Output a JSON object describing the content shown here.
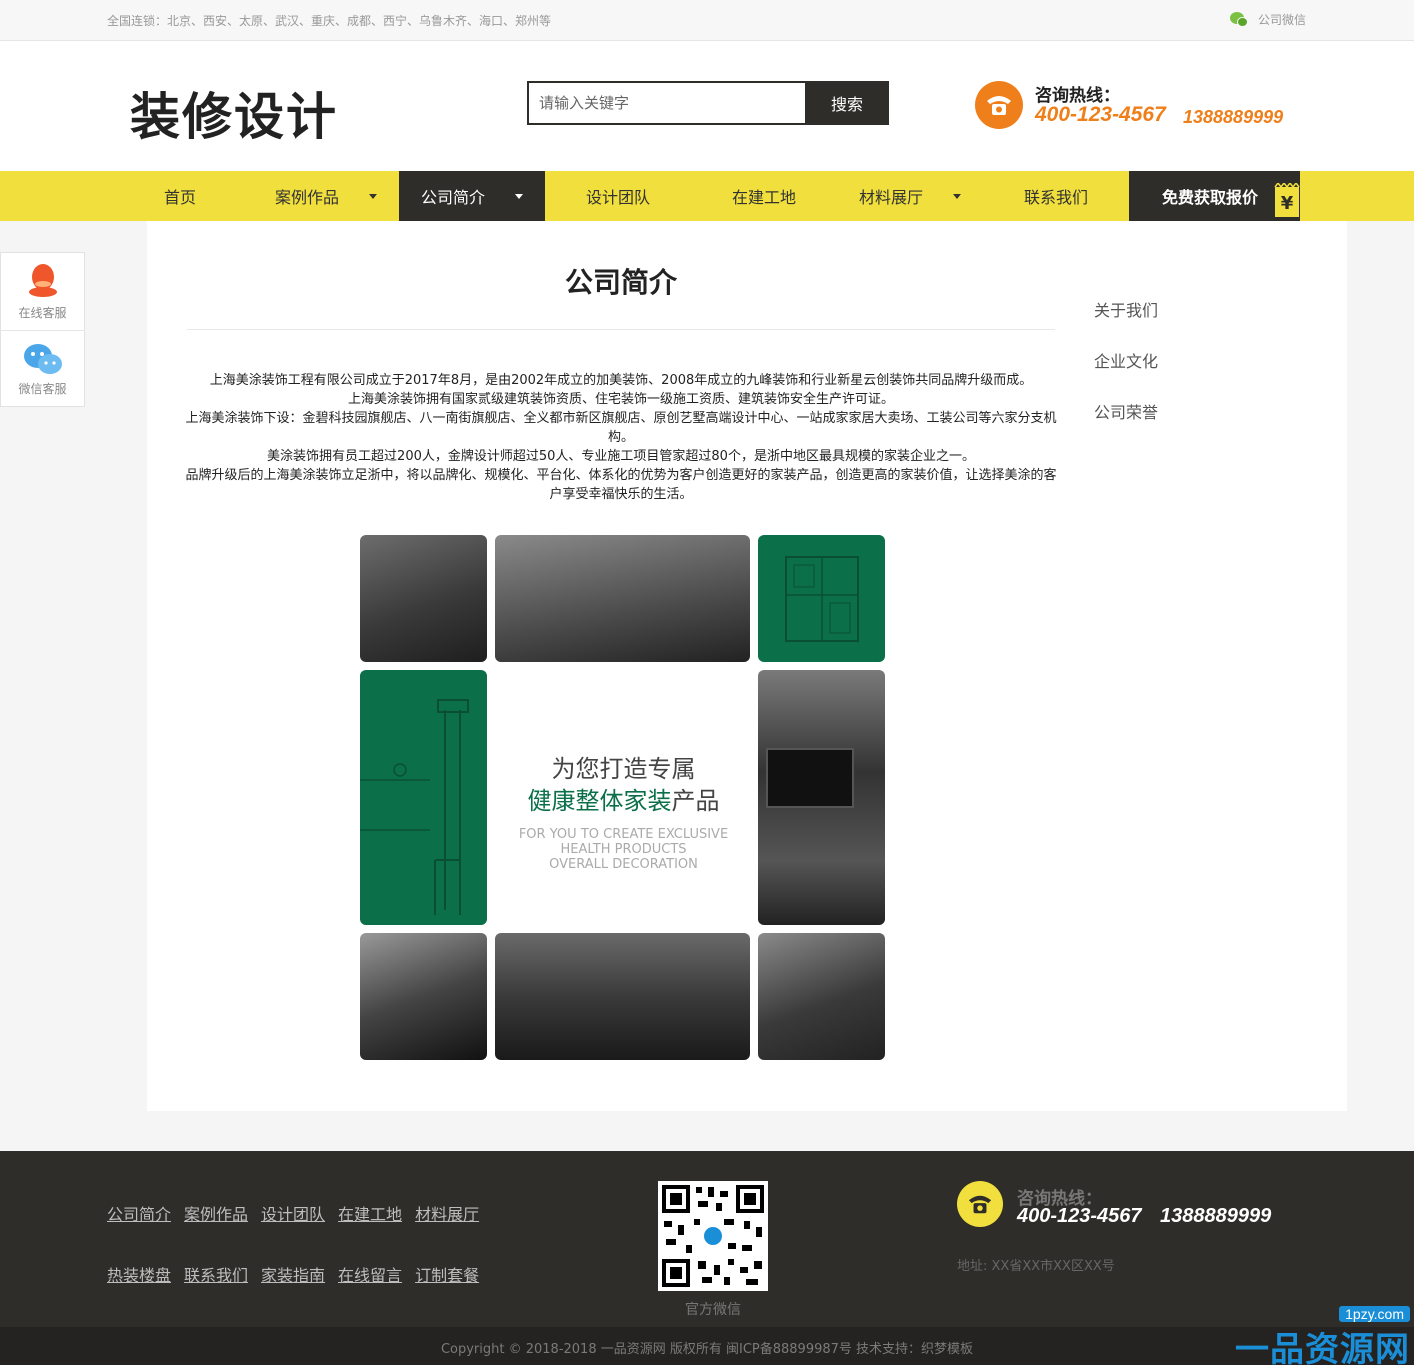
{
  "topbar": {
    "cities": "全国连锁：北京、西安、太原、武汉、重庆、成都、西宁、乌鲁木齐、海口、郑州等",
    "wechat_label": "公司微信"
  },
  "header": {
    "logo": "装修设计",
    "search_placeholder": "请输入关键字",
    "search_button": "搜索",
    "hotline_label": "咨询热线：",
    "hotline_main": "400-123-4567",
    "hotline_mobile": "1388889999"
  },
  "nav": {
    "items": [
      {
        "label": "首页"
      },
      {
        "label": "案例作品"
      },
      {
        "label": "公司简介"
      },
      {
        "label": "设计团队"
      },
      {
        "label": "在建工地"
      },
      {
        "label": "材料展厅"
      },
      {
        "label": "联系我们"
      }
    ],
    "quote_label": "免费获取报价",
    "quote_symbol": "¥"
  },
  "sidefloat": {
    "online_service": "在线客服",
    "wechat_service": "微信客服"
  },
  "main": {
    "title": "公司简介",
    "intro": [
      "上海美涂装饰工程有限公司成立于2017年8月，是由2002年成立的加美装饰、2008年成立的九峰装饰和行业新星云创装饰共同品牌升级而成。",
      "上海美涂装饰拥有国家贰级建筑装饰资质、住宅装饰一级施工资质、建筑装饰安全生产许可证。",
      "上海美涂装饰下设：金碧科技园旗舰店、八一南街旗舰店、全义都市新区旗舰店、原创艺墅高端设计中心、一站成家家居大卖场、工装公司等六家分支机构。",
      "美涂装饰拥有员工超过200人，金牌设计师超过50人、专业施工项目管家超过80个，是浙中地区最具规模的家装企业之一。",
      "品牌升级后的上海美涂装饰立足浙中，将以品牌化、规模化、平台化、体系化的优势为客户创造更好的家装产品，创造更高的家装价值，让选择美涂的客户享受幸福快乐的生活。"
    ],
    "collage": {
      "line1": "为您打造专属",
      "line2_green": "健康整体家装",
      "line2_dark": "产品",
      "en1": "FOR YOU TO CREATE EXCLUSIVE",
      "en2": "HEALTH PRODUCTS",
      "en3": "OVERALL DECORATION"
    },
    "sidemenu": [
      "关于我们",
      "企业文化",
      "公司荣誉"
    ]
  },
  "footer": {
    "links_row1": [
      "公司简介",
      "案例作品",
      "设计团队",
      "在建工地",
      "材料展厅"
    ],
    "links_row2": [
      "热装楼盘",
      "联系我们",
      "家装指南",
      "在线留言",
      "订制套餐"
    ],
    "qr_caption": "官方微信",
    "hotline_label": "咨询热线：",
    "hotline_main": "400-123-4567",
    "hotline_mobile": "1388889999",
    "address": "地址: XX省XX市XX区XX号",
    "copyright": "Copyright © 2018-2018 一品资源网 版权所有 闽ICP备88899987号    技术支持：织梦模板"
  },
  "watermark": {
    "domain": "1pzy.com",
    "brand": "一品资源网"
  },
  "colors": {
    "nav_yellow": "#f0df3c",
    "dark": "#2f2d2a",
    "orange": "#ef7f1a",
    "green": "#0b7049"
  }
}
